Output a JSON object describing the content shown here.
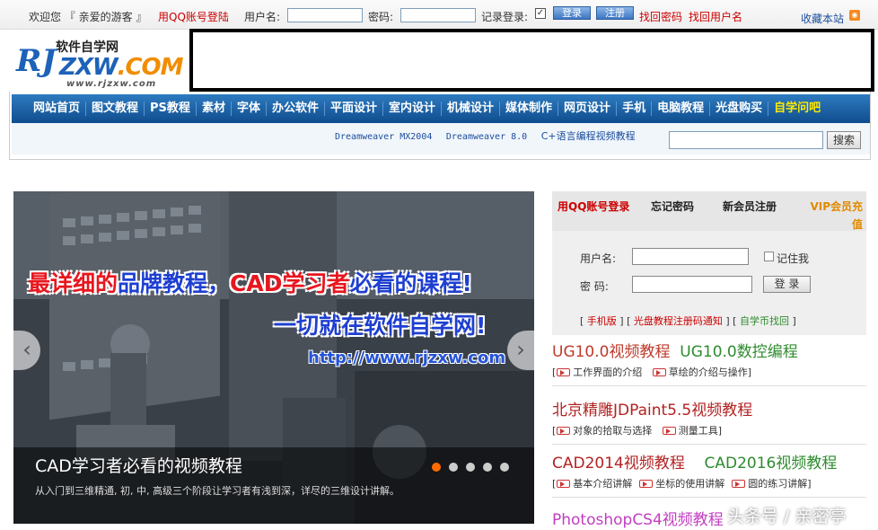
{
  "topbar": {
    "welcome": "欢迎您 『 亲爱的游客 』",
    "qq_login": "用QQ账号登陆",
    "username_label": "用户名:",
    "password_label": "密码:",
    "remember_label": "记录登录:",
    "remember_checked": true,
    "login_btn": "登录",
    "register_btn": "注册",
    "find_password": "找回密码",
    "find_username": "找回用户名",
    "bookmark": "收藏本站"
  },
  "logo": {
    "top_text": "软件自学网",
    "rj": "RJ",
    "zxw": "ZXW",
    "com": ".COM",
    "url": "www.rjzxw.com"
  },
  "nav": {
    "items": [
      "网站首页",
      "图文教程",
      "PS教程",
      "素材",
      "字体",
      "办公软件",
      "平面设计",
      "室内设计",
      "机械设计",
      "媒体制作",
      "网页设计",
      "手机",
      "电脑教程",
      "光盘购买",
      "自学问吧"
    ]
  },
  "subnav": {
    "links": [
      "Dreamweaver MX2004",
      "Dreamweaver 8.0",
      "C+语言编程视频教程"
    ],
    "search_btn": "搜索"
  },
  "slider": {
    "headline_red1": "最详细的",
    "headline_blue": "品牌教程，",
    "headline_red2": "CAD学习者",
    "headline_blue2": "必看的课程!",
    "headline2": "一切就在软件自学网!",
    "url": "http://www.rjzxw.com",
    "caption_title": "CAD学习者必看的视频教程",
    "caption_sub": "从入门到三维精通, 初, 中, 高级三个阶段让学习者有浅到深，详尽的三维设计讲解。",
    "prev": "‹",
    "next": "›",
    "total_slides": 5,
    "active_slide": 1
  },
  "login_panel": {
    "tab_qq": "用QQ账号登录",
    "tab_forgot": "忘记密码",
    "tab_register": "新会员注册",
    "tab_vip": "VIP会员充值",
    "username_label": "用户名:",
    "password_label": "密  码:",
    "remember_me": "记住我",
    "login_btn": "登 录",
    "link_mobile": "手机版",
    "link_notice": "光盘教程注册码通知",
    "link_coins": "自学币找回"
  },
  "courses": [
    {
      "title1": "UG10.0视频教程",
      "title2": "UG10.0数控编程",
      "subs": [
        "工作界面的介绍",
        "草绘的介绍与操作"
      ]
    },
    {
      "title1": "北京精雕JDPaint5.5视频教程",
      "title2": "",
      "subs": [
        "对象的拾取与选择",
        "测量工具"
      ]
    },
    {
      "title1": "CAD2014视频教程",
      "title2": "CAD2016视频教程",
      "subs": [
        "基本介绍讲解",
        "坐标的使用讲解",
        "圆的练习讲解"
      ]
    },
    {
      "title1": "PhotoshopCS4视频教程",
      "title2": "",
      "subs": []
    }
  ],
  "watermark": "头条号 / 亲密亭",
  "colors": {
    "nav_bg": "#0f4d8e",
    "accent_red": "#c00",
    "active_dot": "#ff6a00"
  }
}
